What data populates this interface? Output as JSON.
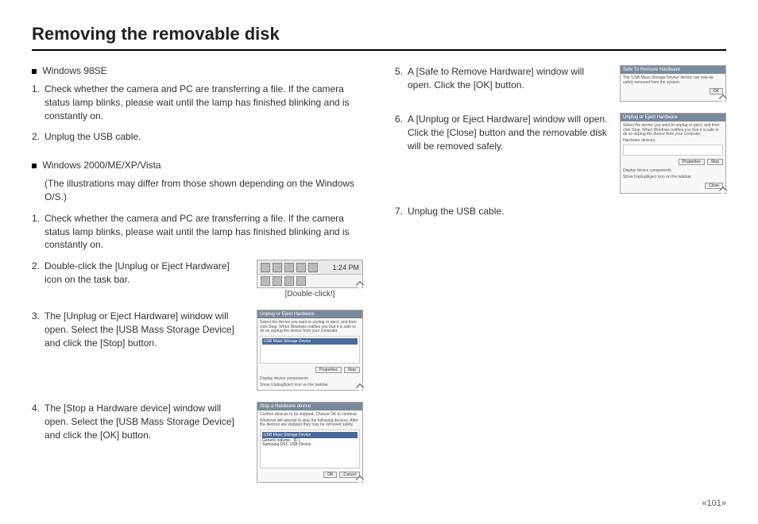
{
  "title": "Removing the removable disk",
  "section_a": {
    "heading": "Windows 98SE",
    "steps": [
      "Check whether the camera and PC are transferring a file. If the camera status lamp blinks, please wait until the lamp has finished blinking and is constantly on.",
      "Unplug the USB cable."
    ]
  },
  "section_b": {
    "heading": "Windows 2000/ME/XP/Vista",
    "note": "(The illustrations may differ from those shown depending on  the Windows O/S.)",
    "steps": [
      "Check whether the camera and PC are transferring a file. If the camera status lamp blinks, please wait until the lamp has finished blinking and is constantly on.",
      "Double-click the [Unplug or Eject Hardware] icon on the task bar.",
      "The [Unplug or Eject Hardware] window will open. Select the [USB Mass Storage Device] and click the [Stop] button.",
      "The [Stop a Hardware device] window will open. Select the [USB Mass Storage Device] and click the [OK] button."
    ],
    "steps_right": [
      "A [Safe to Remove Hardware] window will open. Click the [OK] button.",
      "A [Unplug or Eject Hardware] window will open. Click the [Close] button and the removable disk will be removed safely.",
      "Unplug the USB cable."
    ]
  },
  "figs": {
    "taskbar_clock": "1:24 PM",
    "double_click_caption": "[Double-click!]",
    "dlg_unplug_title": "Unplug or Eject Hardware",
    "dlg_stop_title": "Stop a Hardware device",
    "dlg_safe_title": "Safe To Remove Hardware",
    "dlg_unplug_desc": "Select the device you want to unplug or eject, and then click Stop. When Windows notifies you that it is safe to do so unplug the device from your computer.",
    "dlg_stop_desc": "Confirm devices to be stopped. Choose OK to continue.",
    "dlg_stop_desc2": "Windows will attempt to stop the following devices. After the devices are stopped they may be removed safely.",
    "dlg_safe_text": "The 'USB Mass Storage Device' device can now be safely removed from the system.",
    "item_usb": "USB Mass Storage Device",
    "item_vol": "Generic volume - (F:)",
    "item_sam": "Samsung DSC USB Device",
    "hardware_devices_label": "Hardware devices:",
    "btn_properties": "Properties",
    "btn_stop": "Stop",
    "btn_ok": "OK",
    "btn_cancel": "Cancel",
    "btn_close": "Close",
    "check_display": "Display device components",
    "check_show": "Show Unplug/Eject icon on the taskbar"
  },
  "page_number": "«101»"
}
